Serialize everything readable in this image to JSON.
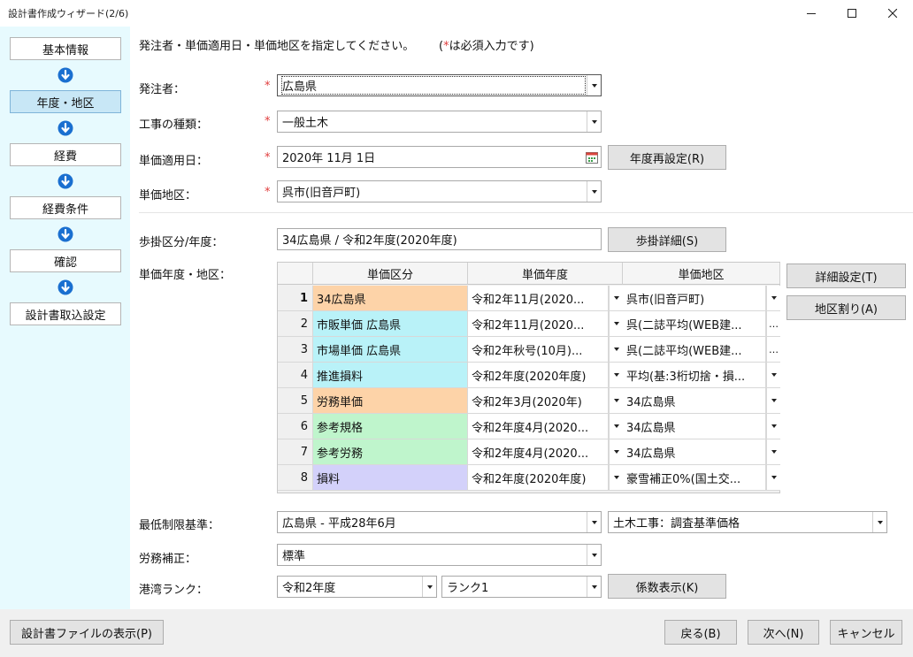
{
  "window": {
    "title": "設計書作成ウィザード(2/6)"
  },
  "sidebar": {
    "steps": [
      {
        "label": "基本情報"
      },
      {
        "label": "年度・地区"
      },
      {
        "label": "経費"
      },
      {
        "label": "経費条件"
      },
      {
        "label": "確認"
      },
      {
        "label": "設計書取込設定"
      }
    ]
  },
  "form": {
    "instruction": "発注者・単価適用日・単価地区を指定してください。",
    "required_note": {
      "open": "(",
      "star": "*",
      "text": "は必須入力です)"
    },
    "required_star": "*",
    "client": {
      "label": "発注者：",
      "value": "広島県"
    },
    "work_type": {
      "label": "工事の種類：",
      "value": "一般土木"
    },
    "price_date": {
      "label": "単価適用日：",
      "value": "2020年 11月 1日"
    },
    "reset_year_button": "年度再設定(R)",
    "price_region": {
      "label": "単価地区：",
      "value": "呉市(旧音戸町)"
    },
    "rate_class": {
      "label": "歩掛区分/年度：",
      "value": "34広島県 / 令和2年度(2020年度)"
    },
    "rate_detail_button": "歩掛詳細(S)",
    "grid_label": "単価年度・地区：",
    "detail_settings_button": "詳細設定(T)",
    "region_assign_button": "地区割り(A)",
    "min_limit": {
      "label": "最低制限基準：",
      "value": "広島県 - 平成28年6月",
      "value2": "土木工事：調査基準価格"
    },
    "labor_adj": {
      "label": "労務補正：",
      "value": "標準"
    },
    "port_rank": {
      "label": "港湾ランク：",
      "value": "令和2年度",
      "value2": "ランク1"
    },
    "coef_button": "係数表示(K)"
  },
  "grid": {
    "headers": [
      "単価区分",
      "単価年度",
      "単価地区"
    ],
    "rows": [
      {
        "no": "1",
        "category": "34広島県",
        "year": "令和2年11月(2020...",
        "region": "呉市(旧音戸町)",
        "color": "#fdd3a8",
        "region_btn": "dropdown"
      },
      {
        "no": "2",
        "category": "市販単価 広島県",
        "year": "令和2年11月(2020...",
        "region": "呉(二誌平均(WEB建...",
        "color": "#b9f2f8",
        "region_btn": "ellipsis"
      },
      {
        "no": "3",
        "category": "市場単価 広島県",
        "year": "令和2年秋号(10月)...",
        "region": "呉(二誌平均(WEB建...",
        "color": "#b9f2f8",
        "region_btn": "ellipsis"
      },
      {
        "no": "4",
        "category": "推進損料",
        "year": "令和2年度(2020年度)",
        "region": "平均(基:3桁切捨・損...",
        "color": "#b9f2f8",
        "region_btn": "dropdown"
      },
      {
        "no": "5",
        "category": "労務単価",
        "year": "令和2年3月(2020年)",
        "region": "34広島県",
        "color": "#fdd3a8",
        "region_btn": "dropdown"
      },
      {
        "no": "6",
        "category": "参考規格",
        "year": "令和2年度4月(2020...",
        "region": "34広島県",
        "color": "#bff5cc",
        "region_btn": "dropdown"
      },
      {
        "no": "7",
        "category": "参考労務",
        "year": "令和2年度4月(2020...",
        "region": "34広島県",
        "color": "#bff5cc",
        "region_btn": "dropdown"
      },
      {
        "no": "8",
        "category": "損料",
        "year": "令和2年度(2020年度)",
        "region": "豪雪補正0%(国土交...",
        "color": "#d3d1fa",
        "region_btn": "dropdown"
      }
    ]
  },
  "footer": {
    "show_file_button": "設計書ファイルの表示(P)",
    "back_button": "戻る(B)",
    "next_button": "次へ(N)",
    "cancel_button": "キャンセル"
  },
  "colors": {
    "sidebar_bg": "#e7fafe",
    "active_step": "#c8e7f6",
    "required_star": "#e03c3c",
    "arrow_blue": "#1a6fd0"
  }
}
